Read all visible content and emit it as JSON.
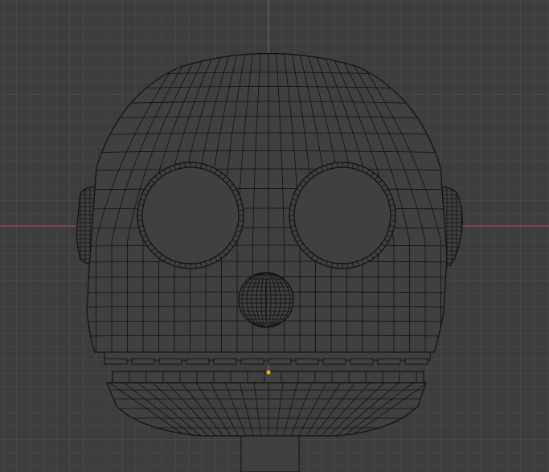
{
  "viewport": {
    "name": "3d-viewport",
    "background": "#3d3d3d",
    "grid_minor_color": "#474747",
    "grid_major_color": "#525252",
    "x_axis_color": "#b0414b",
    "z_axis_color": "#7a8fa3",
    "mesh_fill": "#404040",
    "mesh_wire": "#101010",
    "origin_dot_color": "#f5a623"
  },
  "mesh": {
    "object": "head-mesh",
    "parts": [
      "head",
      "left-eye-socket",
      "right-eye-socket",
      "nose-sphere",
      "left-ear",
      "right-ear",
      "teeth-row",
      "jaw",
      "neck"
    ]
  }
}
